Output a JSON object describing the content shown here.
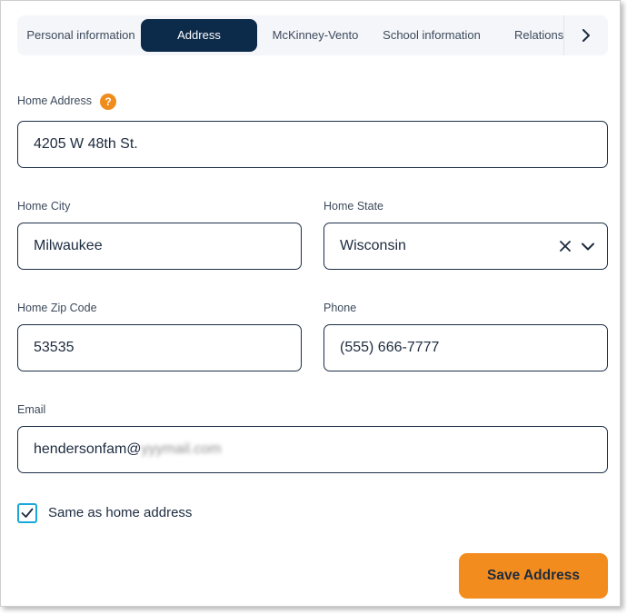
{
  "tabs": [
    {
      "label": "Personal information"
    },
    {
      "label": "Address"
    },
    {
      "label": "McKinney-Vento"
    },
    {
      "label": "School information"
    },
    {
      "label": "Relationships"
    }
  ],
  "active_tab": "Address",
  "form": {
    "home_address": {
      "label": "Home Address",
      "value": "4205 W 48th St."
    },
    "home_city": {
      "label": "Home City",
      "value": "Milwaukee"
    },
    "home_state": {
      "label": "Home State",
      "value": "Wisconsin"
    },
    "home_zip": {
      "label": "Home Zip Code",
      "value": "53535"
    },
    "phone": {
      "label": "Phone",
      "value": "(555) 666-7777"
    },
    "email": {
      "label": "Email",
      "value_visible": "hendersonfam@",
      "value_blurred": "yyymail.com"
    }
  },
  "same_as_home": {
    "label": "Same as home address",
    "checked": true
  },
  "save_button": {
    "label": "Save Address"
  },
  "colors": {
    "accent": "#f28c1e",
    "nav_active": "#0c2a4a",
    "checkbox": "#1aa7d9",
    "help": "#f08c1c"
  },
  "icons": {
    "help": "question-circle-icon",
    "next": "chevron-right-icon",
    "clear": "x-icon",
    "dropdown": "chevron-down-icon",
    "check": "checkmark-icon"
  }
}
